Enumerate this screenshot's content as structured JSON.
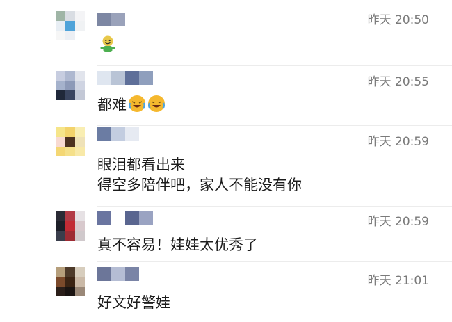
{
  "comments": [
    {
      "time": "昨天 20:50",
      "text": "",
      "emoji": [
        "smiling-green-figure"
      ],
      "avatar_colors": [
        "#9fb5a6",
        "#d9dde3",
        "#f4f4f6",
        "#e8eef4",
        "#4fa3d9",
        "#f0f2f4",
        "#f6f6f6",
        "#eceff4",
        "#ffffff"
      ],
      "name_colors": [
        "#7d87a3",
        "#9aa2ba"
      ]
    },
    {
      "time": "昨天 20:55",
      "text": "都难",
      "emoji": [
        "crying-laughing-face",
        "crying-laughing-face"
      ],
      "avatar_colors": [
        "#c7cde0",
        "#aeb8d0",
        "#e1e4ec",
        "#a5b2cc",
        "#8d9ab8",
        "#cfd4e2",
        "#20283a",
        "#3a4560",
        "#c3c8d6"
      ],
      "name_colors": [
        "#dfe6f0",
        "#b9c4d6",
        "#5e6f99",
        "#8f9fbd"
      ]
    },
    {
      "time": "昨天 20:59",
      "text_lines": [
        "眼泪都看出来",
        "得空多陪伴吧，家人不能没有你"
      ],
      "emoji": [],
      "avatar_colors": [
        "#f6e58a",
        "#f3d36b",
        "#f9eeb3",
        "#f8dad1",
        "#4d3220",
        "#efe2b8",
        "#f4d774",
        "#f5e08a",
        "#f8e9a8"
      ],
      "name_colors": [
        "#6b7ca3",
        "#c3cde0",
        "#e6eaf2"
      ]
    },
    {
      "time": "昨天 20:59",
      "text": "真不容易！娃娃太优秀了",
      "emoji": [],
      "avatar_colors": [
        "#2b2b35",
        "#b23a45",
        "#e6e1e4",
        "#1d1f28",
        "#c22b35",
        "#d8c9cd",
        "#3a3e4c",
        "#9e2b34",
        "#d0c9cc"
      ],
      "name_colors": [
        "#6a75a0",
        "#ffffff",
        "#5a6690",
        "#9aa3c2"
      ]
    },
    {
      "time": "昨天 21:01",
      "text": "好文好警娃",
      "emoji": [],
      "avatar_colors": [
        "#b69f7c",
        "#4d3a2a",
        "#d7cdbd",
        "#7b4a2b",
        "#3b2414",
        "#cab9a7",
        "#2b1f1a",
        "#1a1412",
        "#9a8878"
      ],
      "name_colors": [
        "#6c7699",
        "#b5bdd4",
        "#7a84a6"
      ]
    }
  ]
}
